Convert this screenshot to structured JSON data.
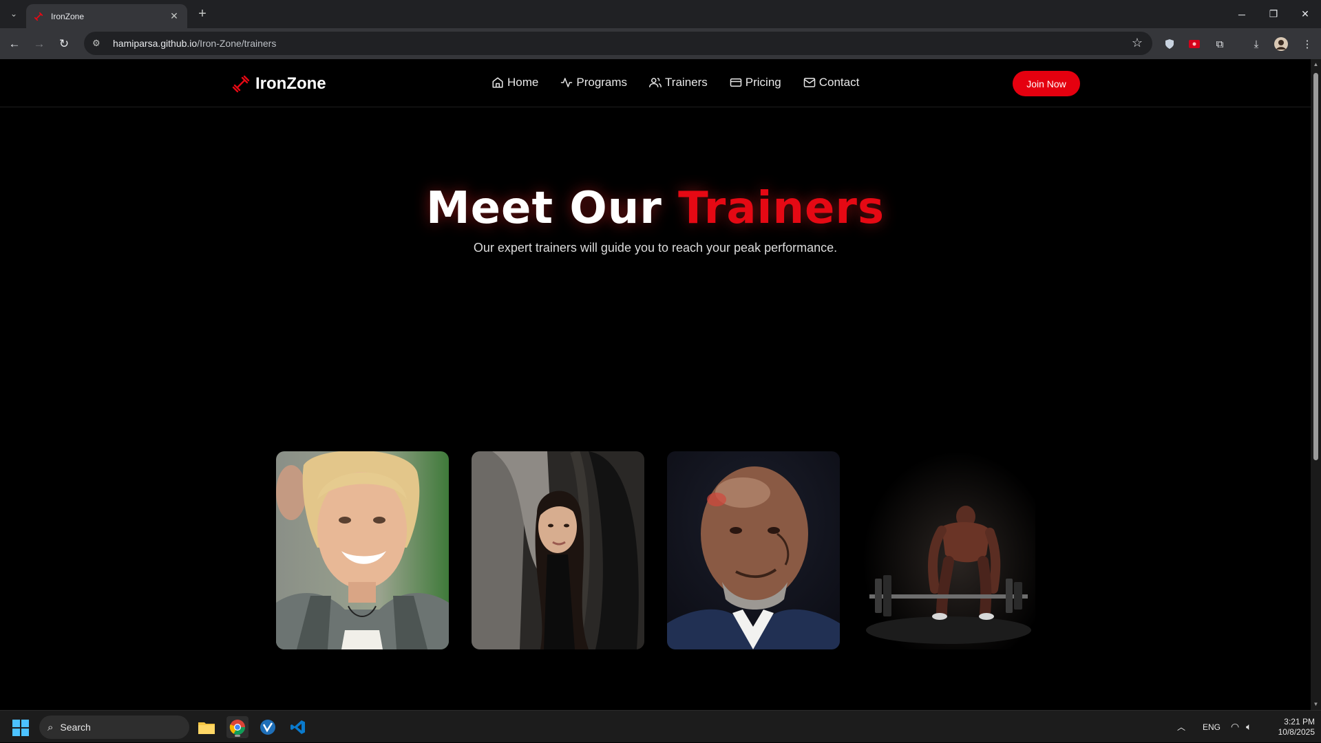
{
  "browser": {
    "tab_title": "IronZone",
    "url_host": "hamiparsa.github.io",
    "url_path": "/Iron-Zone/trainers"
  },
  "site": {
    "brand": "IronZone",
    "nav": [
      {
        "label": "Home",
        "icon": "home-icon"
      },
      {
        "label": "Programs",
        "icon": "activity-icon"
      },
      {
        "label": "Trainers",
        "icon": "users-icon"
      },
      {
        "label": "Pricing",
        "icon": "credit-card-icon"
      },
      {
        "label": "Contact",
        "icon": "mail-icon"
      }
    ],
    "cta_label": "Join Now",
    "accent_color": "#e50914"
  },
  "hero": {
    "title_prefix": "Meet Our",
    "title_accent": "Trainers",
    "subtitle": "Our expert trainers will guide you to reach your peak performance."
  },
  "trainers": [
    {
      "image": "smiling-blonde-woman-photo"
    },
    {
      "image": "dark-haired-woman-gym-photo"
    },
    {
      "image": "bald-man-suit-photo"
    },
    {
      "image": "athlete-barbell-photo"
    }
  ],
  "taskbar": {
    "search_label": "Search",
    "language": "ENG",
    "time": "3:21 PM",
    "date": "10/8/2025"
  }
}
